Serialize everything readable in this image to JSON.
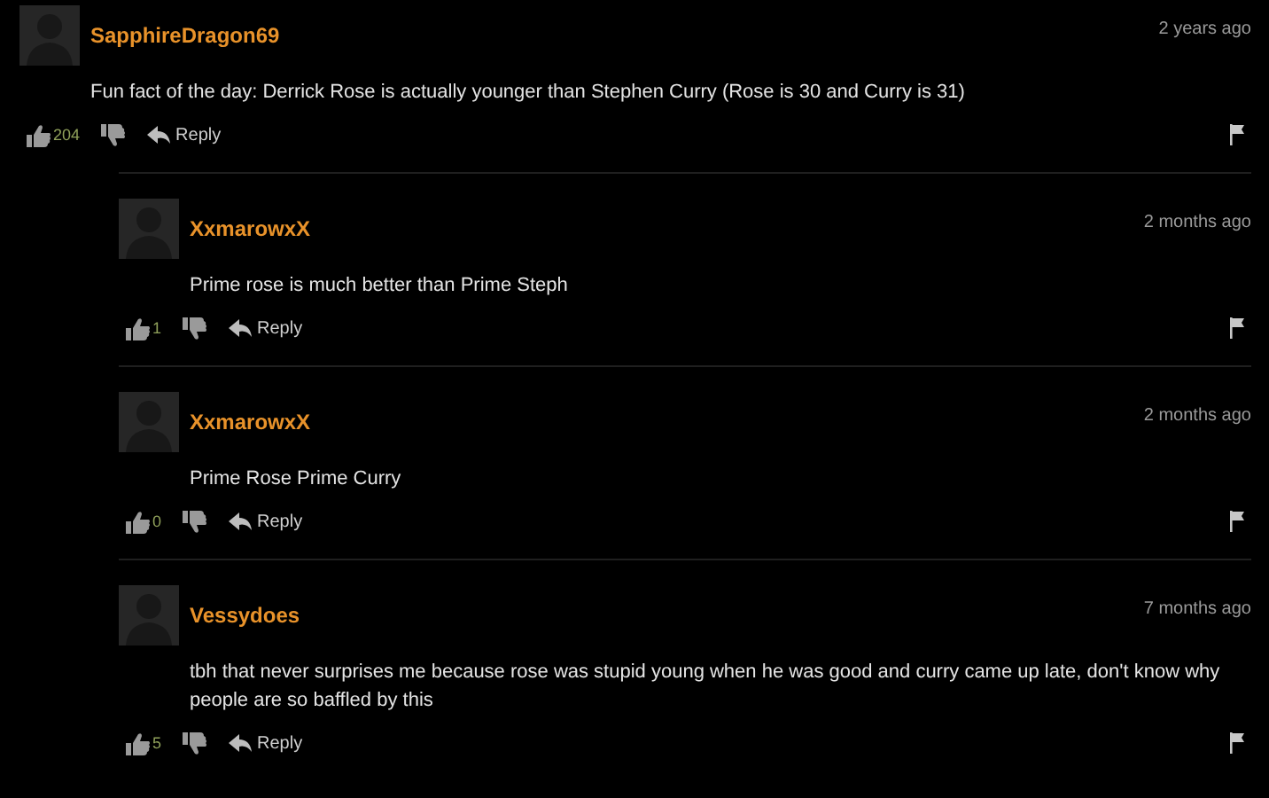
{
  "comment": {
    "username": "SapphireDragon69",
    "time": "2 years ago",
    "text": "Fun fact of the day: Derrick Rose is actually younger than Stephen Curry (Rose is 30 and Curry is 31)",
    "likes": "204",
    "reply": "Reply"
  },
  "replies": [
    {
      "username": "XxmarowxX",
      "time": "2 months ago",
      "text": "Prime rose is much better than Prime Steph",
      "likes": "1",
      "reply": "Reply"
    },
    {
      "username": "XxmarowxX",
      "time": "2 months ago",
      "text": "Prime Rose Prime Curry",
      "likes": "0",
      "reply": "Reply"
    },
    {
      "username": "Vessydoes",
      "time": "7 months ago",
      "text": "tbh that never surprises me because rose was stupid young when he was good and curry came up late, don't know why people are so baffled by this",
      "likes": "5",
      "reply": "Reply"
    }
  ]
}
